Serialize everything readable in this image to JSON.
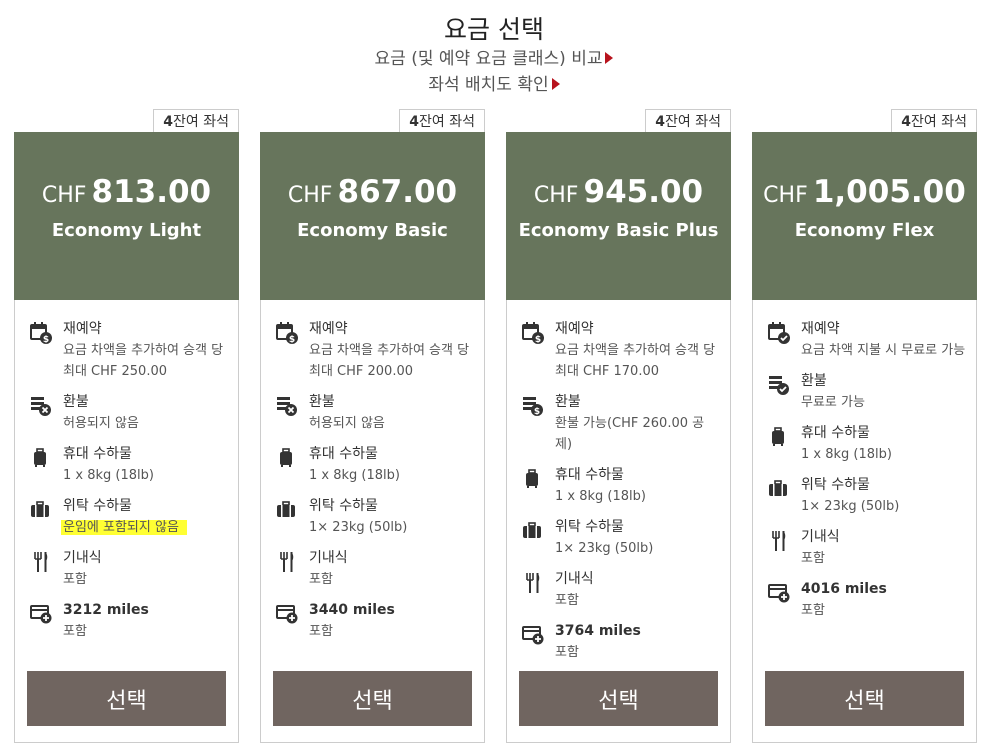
{
  "header": {
    "title": "요금 선택",
    "compare_link": "요금 (및 예약 요금 클래스) 비교",
    "seatmap_link": "좌석 배치도 확인"
  },
  "colors": {
    "card_header": "#67755c",
    "select_button": "#706560",
    "link_arrow": "#b8131d",
    "highlight": "#ffff33"
  },
  "fares": [
    {
      "seats_count": "4",
      "seats_label": "잔여 좌석",
      "currency": "CHF",
      "amount": "813.00",
      "name": "Economy Light",
      "rebooking_title": "재예약",
      "rebooking_desc": "요금 차액을 추가하여 승객 당 최대 CHF 250.00",
      "rebooking_icon": "calendar-dollar-icon",
      "refund_title": "환불",
      "refund_desc": "허용되지 않음",
      "refund_icon": "money-x-icon",
      "carryon_title": "휴대 수하물",
      "carryon_desc": "1 x 8kg (18lb)",
      "checked_title": "위탁 수하물",
      "checked_desc": "운임에 포함되지 않음",
      "meal_title": "기내식",
      "meal_desc": "포함",
      "miles_title": "3212 miles",
      "miles_desc": "포함",
      "button": "선택"
    },
    {
      "seats_count": "4",
      "seats_label": "잔여 좌석",
      "currency": "CHF",
      "amount": "867.00",
      "name": "Economy Basic",
      "rebooking_title": "재예약",
      "rebooking_desc": "요금 차액을 추가하여 승객 당 최대 CHF 200.00",
      "rebooking_icon": "calendar-dollar-icon",
      "refund_title": "환불",
      "refund_desc": "허용되지 않음",
      "refund_icon": "money-x-icon",
      "carryon_title": "휴대 수하물",
      "carryon_desc": "1 x 8kg (18lb)",
      "checked_title": "위탁 수하물",
      "checked_desc": "1× 23kg (50lb)",
      "meal_title": "기내식",
      "meal_desc": "포함",
      "miles_title": "3440 miles",
      "miles_desc": "포함",
      "button": "선택"
    },
    {
      "seats_count": "4",
      "seats_label": "잔여 좌석",
      "currency": "CHF",
      "amount": "945.00",
      "name": "Economy Basic Plus",
      "rebooking_title": "재예약",
      "rebooking_desc": "요금 차액을 추가하여 승객 당 최대 CHF 170.00",
      "rebooking_icon": "calendar-dollar-icon",
      "refund_title": "환불",
      "refund_desc": "환불 가능(CHF 260.00 공제)",
      "refund_icon": "money-dollar-icon",
      "carryon_title": "휴대 수하물",
      "carryon_desc": "1 x 8kg (18lb)",
      "checked_title": "위탁 수하물",
      "checked_desc": "1× 23kg (50lb)",
      "meal_title": "기내식",
      "meal_desc": "포함",
      "miles_title": "3764 miles",
      "miles_desc": "포함",
      "button": "선택"
    },
    {
      "seats_count": "4",
      "seats_label": "잔여 좌석",
      "currency": "CHF",
      "amount": "1,005.00",
      "name": "Economy Flex",
      "rebooking_title": "재예약",
      "rebooking_desc": "요금 차액 지불 시 무료로 가능",
      "rebooking_icon": "calendar-check-icon",
      "refund_title": "환불",
      "refund_desc": "무료로 가능",
      "refund_icon": "money-check-icon",
      "carryon_title": "휴대 수하물",
      "carryon_desc": "1 x 8kg (18lb)",
      "checked_title": "위탁 수하물",
      "checked_desc": "1× 23kg (50lb)",
      "meal_title": "기내식",
      "meal_desc": "포함",
      "miles_title": "4016 miles",
      "miles_desc": "포함",
      "button": "선택"
    }
  ]
}
